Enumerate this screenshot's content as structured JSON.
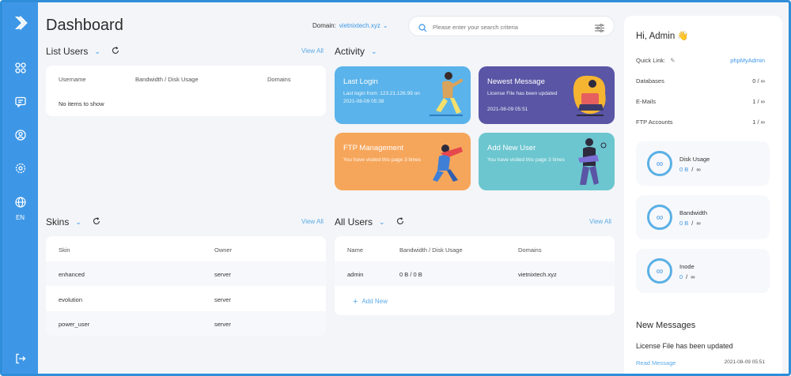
{
  "header": {
    "title": "Dashboard",
    "domain_label": "Domain:",
    "domain_value": "vietnixtech.xyz",
    "search_placeholder": "Please enter your search criteria"
  },
  "sidebar": {
    "icons": [
      "logo-icon",
      "dashboard-grid-icon",
      "message-icon",
      "user-circle-icon",
      "gear-icon",
      "globe-icon",
      "logout-icon"
    ],
    "language": "EN"
  },
  "list_users": {
    "title": "List Users",
    "view_all": "View All",
    "columns": [
      "Username",
      "Bandwidth / Disk Usage",
      "Domains"
    ],
    "empty_text": "No items to show"
  },
  "activity": {
    "title": "Activity",
    "tiles": [
      {
        "title": "Last Login",
        "line1": "Last login from: 123.21.126.99 on",
        "line2": "2021-08-09 05:38",
        "color": "#5ab3ea"
      },
      {
        "title": "Newest Message",
        "line1": "License File has been updated",
        "line2": "2021-08-09 05:51",
        "color": "#5a55a5"
      },
      {
        "title": "FTP Management",
        "line1": "You have visited this page 3 times",
        "line2": "",
        "color": "#f6a65b"
      },
      {
        "title": "Add New User",
        "line1": "You have visited this page 3 times",
        "line2": "",
        "color": "#6cc6cf"
      }
    ]
  },
  "skins": {
    "title": "Skins",
    "view_all": "View All",
    "columns": [
      "Skin",
      "Owner"
    ],
    "rows": [
      {
        "skin": "enhanced",
        "owner": "server"
      },
      {
        "skin": "evolution",
        "owner": "server"
      },
      {
        "skin": "power_user",
        "owner": "server"
      }
    ]
  },
  "all_users": {
    "title": "All Users",
    "view_all": "View All",
    "columns": [
      "Name",
      "Bandwidth / Disk Usage",
      "Domains"
    ],
    "rows": [
      {
        "name": "admin",
        "usage": "0 B / 0 B",
        "domains": "vietnixtech.xyz"
      }
    ],
    "add_new": "Add New"
  },
  "right_panel": {
    "greeting": "Hi, Admin 👋",
    "quick_link_label": "Quick Link:",
    "quick_link_value": "phpMyAdmin",
    "stats": [
      {
        "label": "Databases",
        "value": "0 / ∞"
      },
      {
        "label": "E-Mails",
        "value": "1 / ∞"
      },
      {
        "label": "FTP Accounts",
        "value": "1 / ∞"
      }
    ],
    "usage": [
      {
        "label": "Disk Usage",
        "used": "0 B",
        "limit": "∞"
      },
      {
        "label": "Bandwidth",
        "used": "0 B",
        "limit": "∞"
      },
      {
        "label": "Inode",
        "used": "0",
        "limit": "∞"
      }
    ],
    "new_messages_title": "New Messages",
    "message_subject": "License File has been updated",
    "read_message": "Read Message",
    "message_date": "2021-08-09 05:51"
  },
  "colors": {
    "accent": "#3e97e6",
    "sidebar": "#3e97e6"
  }
}
